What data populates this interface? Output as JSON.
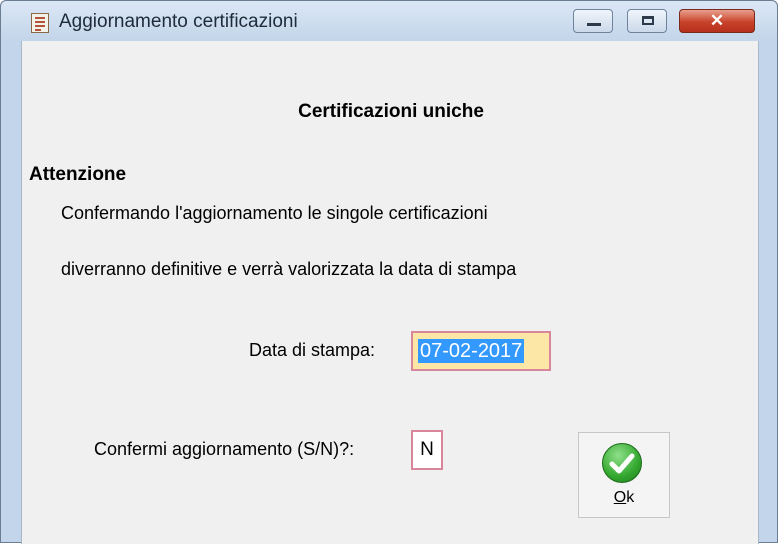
{
  "window": {
    "title": "Aggiornamento certificazioni",
    "controls": {
      "minimize": "minimize",
      "maximize": "maximize",
      "close": "✕"
    }
  },
  "dialog": {
    "heading": "Certificazioni uniche",
    "attention_title": "Attenzione",
    "message_line1": "Confermando l'aggiornamento le singole certificazioni",
    "message_line2": "diverranno definitive e verrà valorizzata la data di stampa",
    "print_date_label": "Data di stampa:",
    "print_date_value": "07-02-2017",
    "confirm_label": "Confermi aggiornamento (S/N)?:",
    "confirm_value": "N",
    "ok_button": {
      "mnemonic": "O",
      "rest": "k",
      "icon": "green-checkmark-icon"
    }
  },
  "colors": {
    "titlebar": "#c3d5ea",
    "client_bg": "#f0f0f0",
    "field_border": "#d8869a",
    "date_field_bg": "#fde7a6",
    "selection": "#3399ff",
    "close_button": "#c8422a",
    "ok_icon": "#33a82f"
  }
}
